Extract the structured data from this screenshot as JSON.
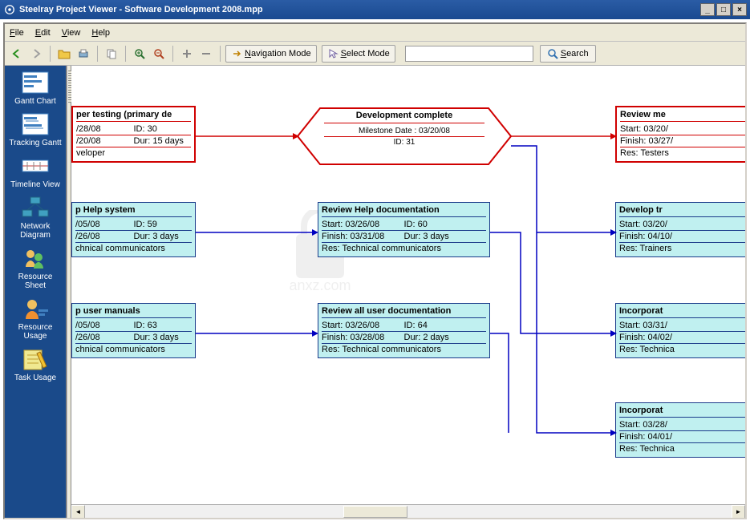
{
  "window": {
    "title": "Steelray Project Viewer - Software Development 2008.mpp"
  },
  "menu": {
    "file": "File",
    "edit": "Edit",
    "view": "View",
    "help": "Help"
  },
  "toolbar": {
    "navigation_mode": "Navigation Mode",
    "select_mode": "Select Mode",
    "search": "Search",
    "search_value": ""
  },
  "sidebar": {
    "gantt_chart": "Gantt Chart",
    "tracking_gantt": "Tracking Gantt",
    "timeline_view": "Timeline View",
    "network_diagram": "Network Diagram",
    "resource_sheet": "Resource Sheet",
    "resource_usage": "Resource Usage",
    "task_usage": "Task Usage"
  },
  "nodes": {
    "t30": {
      "title": "per testing (primary de",
      "row1a": "/28/08",
      "row1b": "ID:  30",
      "row2a": "/20/08",
      "row2b": "Dur: 15 days",
      "row3": "veloper"
    },
    "t59": {
      "title": "p Help system",
      "row1a": "/05/08",
      "row1b": "ID:  59",
      "row2a": "/26/08",
      "row2b": "Dur: 3 days",
      "row3": "chnical communicators"
    },
    "t63": {
      "title": "p user manuals",
      "row1a": "/05/08",
      "row1b": "ID:  63",
      "row2a": "/26/08",
      "row2b": "Dur: 3 days",
      "row3": "chnical communicators"
    },
    "milestone": {
      "title": "Development complete",
      "date": "Milestone Date : 03/20/08",
      "id": "ID: 31"
    },
    "t60": {
      "title": "Review Help documentation",
      "start": "Start:  03/26/08",
      "id": "ID:  60",
      "finish": "Finish: 03/31/08",
      "dur": "Dur: 3 days",
      "res": "Res:  Technical communicators"
    },
    "t64": {
      "title": "Review all user documentation",
      "start": "Start:  03/26/08",
      "id": "ID:  64",
      "finish": "Finish: 03/28/08",
      "dur": "Dur: 2 days",
      "res": "Res:  Technical communicators"
    },
    "r1": {
      "title": "Review me",
      "r1": "Start:  03/20/",
      "r2": "Finish: 03/27/",
      "r3": "Res: Testers"
    },
    "r2": {
      "title": "Develop tr",
      "r1": "Start:  03/20/",
      "r2": "Finish: 04/10/",
      "r3": "Res: Trainers"
    },
    "r3": {
      "title": "Incorporat",
      "r1": "Start:  03/31/",
      "r2": "Finish: 04/02/",
      "r3": "Res: Technica"
    },
    "r4": {
      "title": "Incorporat",
      "r1": "Start:  03/28/",
      "r2": "Finish: 04/01/",
      "r3": "Res: Technica"
    }
  },
  "watermark": "anxz.com"
}
